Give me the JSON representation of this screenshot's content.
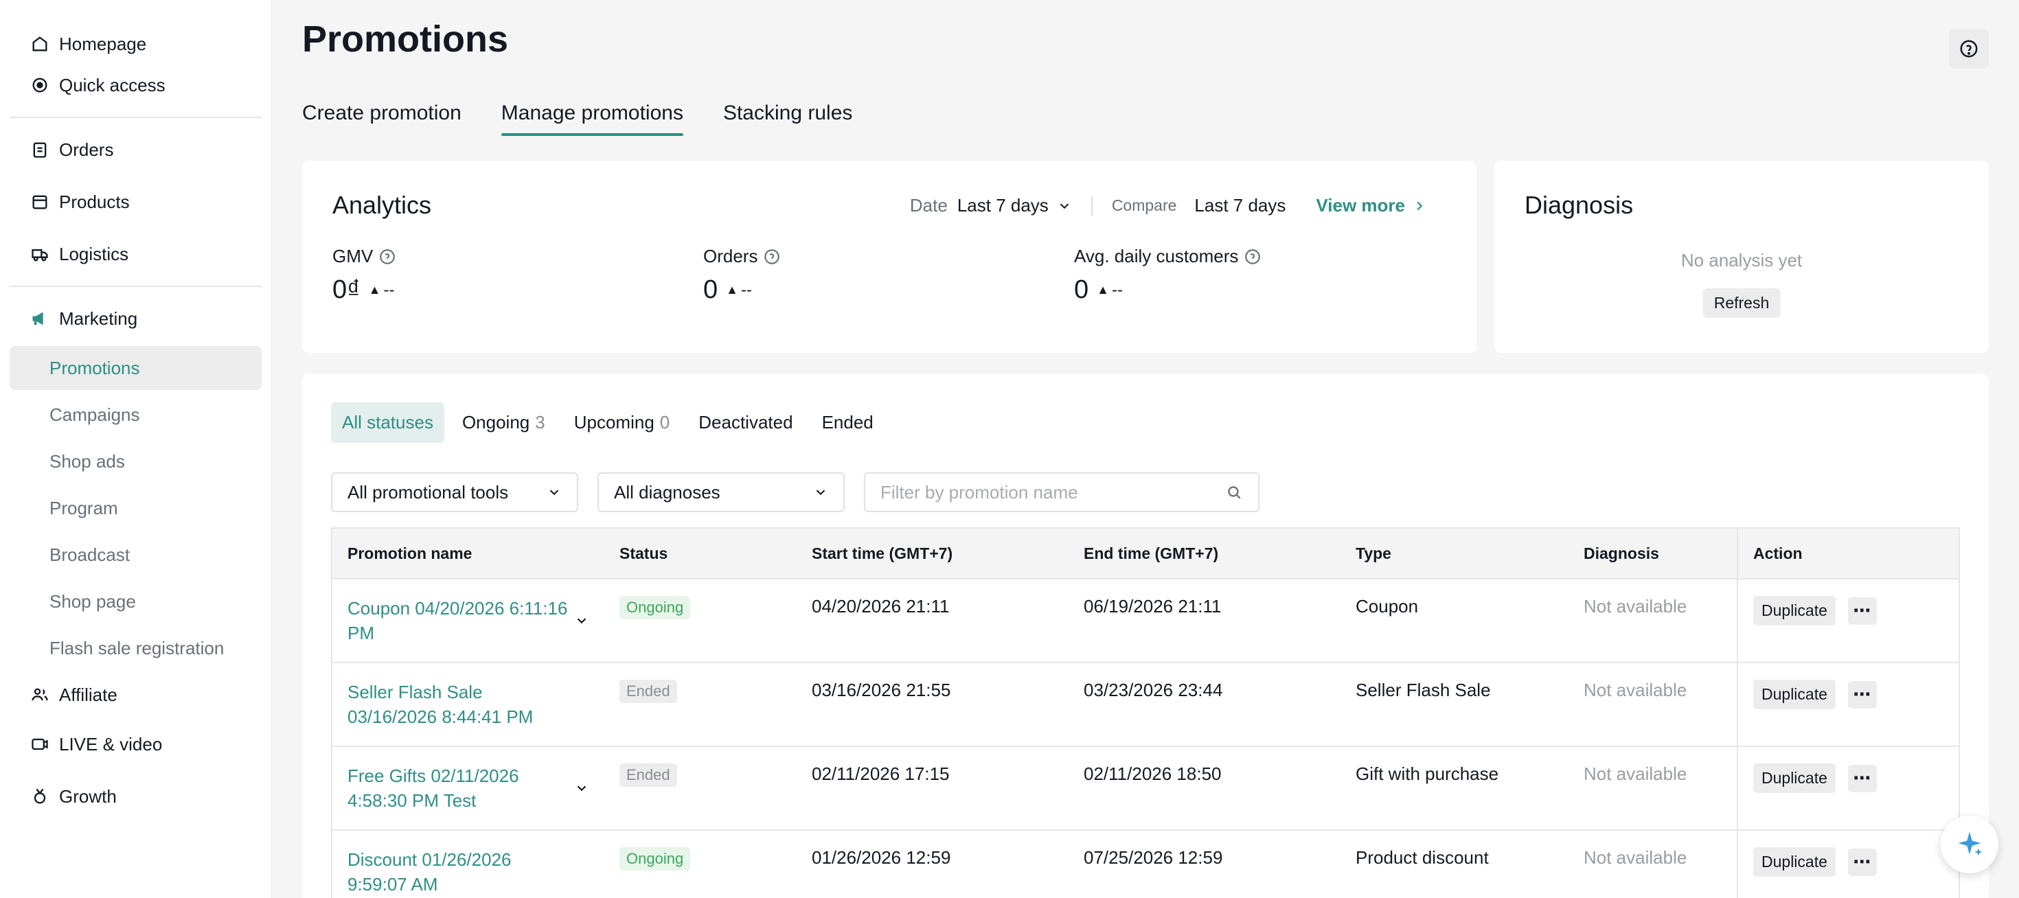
{
  "sidebar": {
    "items": [
      {
        "label": "Homepage",
        "icon": "home-icon"
      },
      {
        "label": "Quick access",
        "icon": "quick-access-icon"
      },
      {
        "label": "Orders",
        "icon": "clipboard-icon"
      },
      {
        "label": "Products",
        "icon": "box-icon"
      },
      {
        "label": "Logistics",
        "icon": "truck-icon"
      },
      {
        "label": "Marketing",
        "icon": "megaphone-icon"
      },
      {
        "label": "Affiliate",
        "icon": "people-icon"
      },
      {
        "label": "LIVE & video",
        "icon": "video-icon"
      },
      {
        "label": "Growth",
        "icon": "medal-icon"
      }
    ],
    "marketing_sub": [
      "Promotions",
      "Campaigns",
      "Shop ads",
      "Program",
      "Broadcast",
      "Shop page",
      "Flash sale registration"
    ]
  },
  "header": {
    "title": "Promotions",
    "tabs": [
      "Create promotion",
      "Manage promotions",
      "Stacking rules"
    ]
  },
  "analytics": {
    "title": "Analytics",
    "date_label": "Date",
    "date_value": "Last 7 days",
    "compare_label": "Compare",
    "compare_value": "Last 7 days",
    "view_more": "View more",
    "metrics": [
      {
        "label": "GMV",
        "value": "0₫",
        "trend": "--"
      },
      {
        "label": "Orders",
        "value": "0",
        "trend": "--"
      },
      {
        "label": "Avg. daily customers",
        "value": "0",
        "trend": "--"
      }
    ]
  },
  "diagnosis": {
    "title": "Diagnosis",
    "empty": "No analysis yet",
    "refresh": "Refresh"
  },
  "status_tabs": [
    {
      "label": "All statuses",
      "count": ""
    },
    {
      "label": "Ongoing",
      "count": "3"
    },
    {
      "label": "Upcoming",
      "count": "0"
    },
    {
      "label": "Deactivated",
      "count": ""
    },
    {
      "label": "Ended",
      "count": ""
    }
  ],
  "filters": {
    "tools": "All promotional tools",
    "diagnoses": "All diagnoses",
    "search_placeholder": "Filter by promotion name"
  },
  "table": {
    "headers": [
      "Promotion name",
      "Status",
      "Start time (GMT+7)",
      "End time (GMT+7)",
      "Type",
      "Diagnosis",
      "Action"
    ],
    "rows": [
      {
        "name": "Coupon 04/20/2026 6:11:16 PM",
        "status": "Ongoing",
        "start": "04/20/2026 21:11",
        "end": "06/19/2026 21:11",
        "type": "Coupon",
        "diagnosis": "Not available",
        "action": "Duplicate"
      },
      {
        "name": "Seller Flash Sale 03/16/2026 8:44:41 PM",
        "status": "Ended",
        "start": "03/16/2026 21:55",
        "end": "03/23/2026 23:44",
        "type": "Seller Flash Sale",
        "diagnosis": "Not available",
        "action": "Duplicate"
      },
      {
        "name": "Free Gifts 02/11/2026 4:58:30 PM Test",
        "status": "Ended",
        "start": "02/11/2026 17:15",
        "end": "02/11/2026 18:50",
        "type": "Gift with purchase",
        "diagnosis": "Not available",
        "action": "Duplicate"
      },
      {
        "name": "Discount 01/26/2026 9:59:07 AM",
        "status": "Ongoing",
        "start": "01/26/2026 12:59",
        "end": "07/25/2026 12:59",
        "type": "Product discount",
        "diagnosis": "Not available",
        "action": "Duplicate"
      }
    ]
  },
  "colors": {
    "accent": "#2e8f86",
    "ongoing": "#3aa85a",
    "muted": "#9a9ca4"
  }
}
